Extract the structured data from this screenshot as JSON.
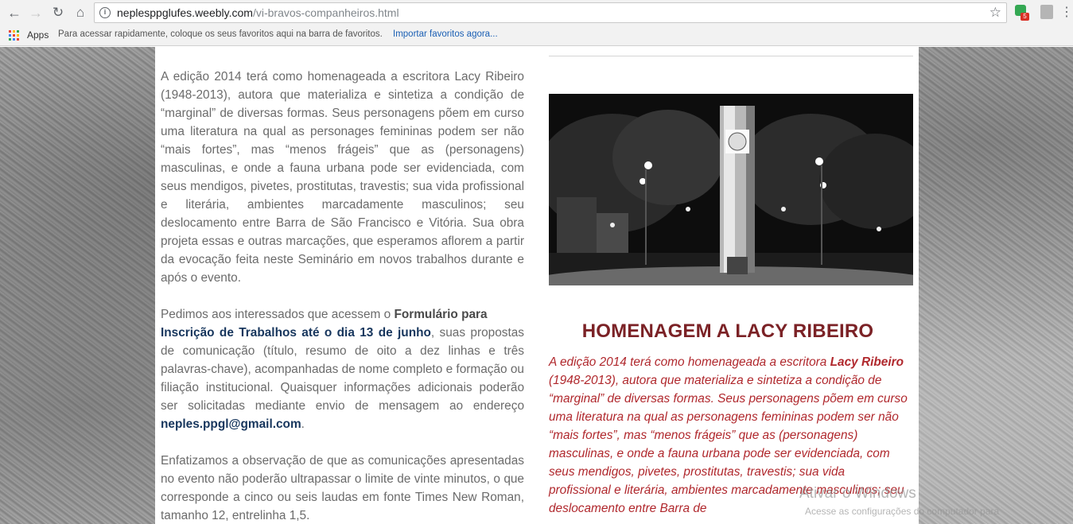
{
  "browser": {
    "url_host": "neplesppglufes.weebly.com",
    "url_path": "/vi-bravos-companheiros.html",
    "extension_badge": "5"
  },
  "bookmarks": {
    "apps_label": "Apps",
    "hint": "Para acessar rapidamente, coloque os seus favoritos aqui na barra de favoritos.",
    "import_link": "Importar favoritos agora..."
  },
  "left": {
    "p1": "A edição 2014 terá como homenageada a escritora Lacy Ribeiro (1948-2013), autora que materializa e sintetiza a condição de “marginal” de diversas formas. Seus personagens põem em curso uma literatura na qual as personages femininas podem ser não “mais fortes”, mas “menos frágeis” que as (personagens) masculinas, e onde a fauna urbana pode ser evidenciada, com seus mendigos, pivetes, prostitutas, travestis; sua vida profissional e literária, ambientes marcadamente masculinos; seu deslocamento entre Barra de São Francisco e Vitória. Sua obra projeta essas e outras marcações, que esperamos aflorem a partir da evocação feita neste Seminário em novos trabalhos durante e após o evento.",
    "p2_a": "Pedimos aos interessados que acessem o ",
    "p2_bold": "Formulário para",
    "p2_link": "Inscrição de Trabalhos até o dia 13 de junho",
    "p2_b": ", suas propostas de comunicação (título, resumo de oito a dez linhas e três palavras-chave), acompanhadas de nome completo e formação ou filiação institucional. Quaisquer informações adicionais poderão ser solicitadas mediante envio de mensagem ao endereço ",
    "p2_email": "neples.ppgl@gmail.com",
    "p2_end": ".",
    "p3": "Enfatizamos a observação de que as comunicações apresentadas no evento não poderão ultrapassar o limite de vinte minutos, o que corresponde a cinco ou seis laudas em fonte Times New Roman, tamanho 12, entrelinha 1,5."
  },
  "right": {
    "heading": "HOMENAGEM A LACY RIBEIRO",
    "text_a": "A edição 2014 terá como homenageada a escritora ",
    "text_bold": "Lacy Ribeiro",
    "text_b": " (1948-2013), autora que materializa e sintetiza a condição de “marginal” de diversas formas. Seus personagens põem em curso uma literatura na qual as personagens femininas podem ser não “mais fortes”, mas “menos frágeis” que as (personagens) masculinas, e onde a fauna urbana pode ser evidenciada, com seus mendigos, pivetes, prostitutas, travestis; sua vida profissional e literária, ambientes marcadamente masculinos; seu deslocamento entre Barra de"
  },
  "overlay": {
    "watermark": "Ativar o Windows",
    "watermark_sub": "Acesse as configurações do computador para"
  },
  "colors": {
    "heading": "#7b2226",
    "red_text": "#b0282d",
    "link_blue": "#17365d"
  }
}
